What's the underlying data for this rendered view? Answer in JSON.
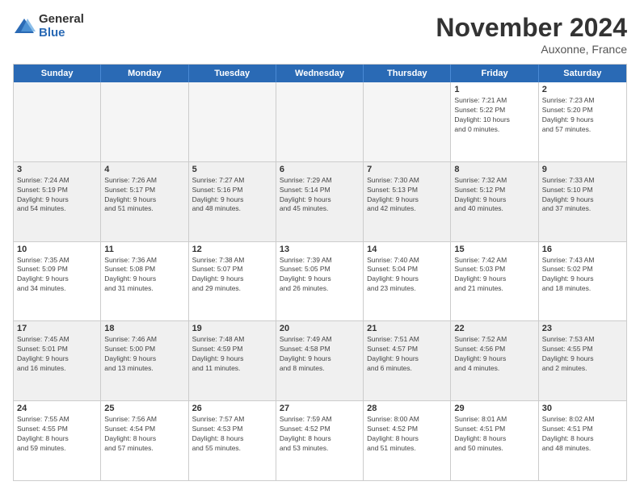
{
  "logo": {
    "general": "General",
    "blue": "Blue"
  },
  "title": "November 2024",
  "location": "Auxonne, France",
  "header_days": [
    "Sunday",
    "Monday",
    "Tuesday",
    "Wednesday",
    "Thursday",
    "Friday",
    "Saturday"
  ],
  "weeks": [
    [
      {
        "day": "",
        "info": "",
        "empty": true
      },
      {
        "day": "",
        "info": "",
        "empty": true
      },
      {
        "day": "",
        "info": "",
        "empty": true
      },
      {
        "day": "",
        "info": "",
        "empty": true
      },
      {
        "day": "",
        "info": "",
        "empty": true
      },
      {
        "day": "1",
        "info": "Sunrise: 7:21 AM\nSunset: 5:22 PM\nDaylight: 10 hours\nand 0 minutes."
      },
      {
        "day": "2",
        "info": "Sunrise: 7:23 AM\nSunset: 5:20 PM\nDaylight: 9 hours\nand 57 minutes."
      }
    ],
    [
      {
        "day": "3",
        "info": "Sunrise: 7:24 AM\nSunset: 5:19 PM\nDaylight: 9 hours\nand 54 minutes."
      },
      {
        "day": "4",
        "info": "Sunrise: 7:26 AM\nSunset: 5:17 PM\nDaylight: 9 hours\nand 51 minutes."
      },
      {
        "day": "5",
        "info": "Sunrise: 7:27 AM\nSunset: 5:16 PM\nDaylight: 9 hours\nand 48 minutes."
      },
      {
        "day": "6",
        "info": "Sunrise: 7:29 AM\nSunset: 5:14 PM\nDaylight: 9 hours\nand 45 minutes."
      },
      {
        "day": "7",
        "info": "Sunrise: 7:30 AM\nSunset: 5:13 PM\nDaylight: 9 hours\nand 42 minutes."
      },
      {
        "day": "8",
        "info": "Sunrise: 7:32 AM\nSunset: 5:12 PM\nDaylight: 9 hours\nand 40 minutes."
      },
      {
        "day": "9",
        "info": "Sunrise: 7:33 AM\nSunset: 5:10 PM\nDaylight: 9 hours\nand 37 minutes."
      }
    ],
    [
      {
        "day": "10",
        "info": "Sunrise: 7:35 AM\nSunset: 5:09 PM\nDaylight: 9 hours\nand 34 minutes."
      },
      {
        "day": "11",
        "info": "Sunrise: 7:36 AM\nSunset: 5:08 PM\nDaylight: 9 hours\nand 31 minutes."
      },
      {
        "day": "12",
        "info": "Sunrise: 7:38 AM\nSunset: 5:07 PM\nDaylight: 9 hours\nand 29 minutes."
      },
      {
        "day": "13",
        "info": "Sunrise: 7:39 AM\nSunset: 5:05 PM\nDaylight: 9 hours\nand 26 minutes."
      },
      {
        "day": "14",
        "info": "Sunrise: 7:40 AM\nSunset: 5:04 PM\nDaylight: 9 hours\nand 23 minutes."
      },
      {
        "day": "15",
        "info": "Sunrise: 7:42 AM\nSunset: 5:03 PM\nDaylight: 9 hours\nand 21 minutes."
      },
      {
        "day": "16",
        "info": "Sunrise: 7:43 AM\nSunset: 5:02 PM\nDaylight: 9 hours\nand 18 minutes."
      }
    ],
    [
      {
        "day": "17",
        "info": "Sunrise: 7:45 AM\nSunset: 5:01 PM\nDaylight: 9 hours\nand 16 minutes."
      },
      {
        "day": "18",
        "info": "Sunrise: 7:46 AM\nSunset: 5:00 PM\nDaylight: 9 hours\nand 13 minutes."
      },
      {
        "day": "19",
        "info": "Sunrise: 7:48 AM\nSunset: 4:59 PM\nDaylight: 9 hours\nand 11 minutes."
      },
      {
        "day": "20",
        "info": "Sunrise: 7:49 AM\nSunset: 4:58 PM\nDaylight: 9 hours\nand 8 minutes."
      },
      {
        "day": "21",
        "info": "Sunrise: 7:51 AM\nSunset: 4:57 PM\nDaylight: 9 hours\nand 6 minutes."
      },
      {
        "day": "22",
        "info": "Sunrise: 7:52 AM\nSunset: 4:56 PM\nDaylight: 9 hours\nand 4 minutes."
      },
      {
        "day": "23",
        "info": "Sunrise: 7:53 AM\nSunset: 4:55 PM\nDaylight: 9 hours\nand 2 minutes."
      }
    ],
    [
      {
        "day": "24",
        "info": "Sunrise: 7:55 AM\nSunset: 4:55 PM\nDaylight: 8 hours\nand 59 minutes."
      },
      {
        "day": "25",
        "info": "Sunrise: 7:56 AM\nSunset: 4:54 PM\nDaylight: 8 hours\nand 57 minutes."
      },
      {
        "day": "26",
        "info": "Sunrise: 7:57 AM\nSunset: 4:53 PM\nDaylight: 8 hours\nand 55 minutes."
      },
      {
        "day": "27",
        "info": "Sunrise: 7:59 AM\nSunset: 4:52 PM\nDaylight: 8 hours\nand 53 minutes."
      },
      {
        "day": "28",
        "info": "Sunrise: 8:00 AM\nSunset: 4:52 PM\nDaylight: 8 hours\nand 51 minutes."
      },
      {
        "day": "29",
        "info": "Sunrise: 8:01 AM\nSunset: 4:51 PM\nDaylight: 8 hours\nand 50 minutes."
      },
      {
        "day": "30",
        "info": "Sunrise: 8:02 AM\nSunset: 4:51 PM\nDaylight: 8 hours\nand 48 minutes."
      }
    ]
  ]
}
